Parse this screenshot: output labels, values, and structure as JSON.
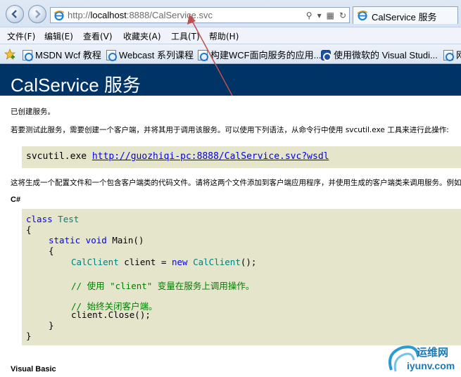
{
  "browser": {
    "url_prefix": "http://",
    "url_host": "localhost",
    "url_rest": ":8888/CalService.svc",
    "tab_title": "CalService 服务"
  },
  "menu": [
    "文件(F)",
    "编辑(E)",
    "查看(V)",
    "收藏夹(A)",
    "工具(T)",
    "帮助(H)"
  ],
  "favorites": [
    "MSDN Wcf 教程",
    "Webcast 系列课程",
    "构建WCF面向服务的应用...",
    "使用微软的 Visual Studi...",
    "网"
  ],
  "page": {
    "title": "CalService 服务",
    "created": "已创建服务。",
    "instructions": "若要测试此服务，需要创建一个客户端，并将其用于调用该服务。可以使用下列语法，从命令行中使用 svcutil.exe 工具来进行此操作:",
    "svcutil_cmd": "svcutil.exe",
    "wsdl_link": "http://guozhiqi-pc:8888/CalService.svc?wsdl",
    "generate_note": "这将生成一个配置文件和一个包含客户端类的代码文件。请将这两个文件添加到客户端应用程序，并使用生成的客户端类来调用服务。例如:",
    "csharp_heading": "C#",
    "vb_heading": "Visual Basic"
  },
  "code": {
    "kw_class": "class",
    "type_test": "Test",
    "open_brace": "{",
    "close_brace": "}",
    "kw_static_void": "static void",
    "method_main": " Main()",
    "type_calclient": "CalClient",
    "decl_rest": " client = ",
    "kw_new": "new",
    "ctor_end": "();",
    "comment_call": "// 使用 \"client\" 变量在服务上调用操作。",
    "comment_close": "// 始终关闭客户端。",
    "close_call": "client.Close();"
  },
  "watermark": {
    "cn": "运维网",
    "en": "iyunv.com"
  },
  "colors": {
    "banner": "#003366",
    "code_bg": "#e5e5cc",
    "keyword": "#0000ff",
    "type": "#008080",
    "comment": "#008000",
    "annotation_arrow": "#c0504d"
  }
}
